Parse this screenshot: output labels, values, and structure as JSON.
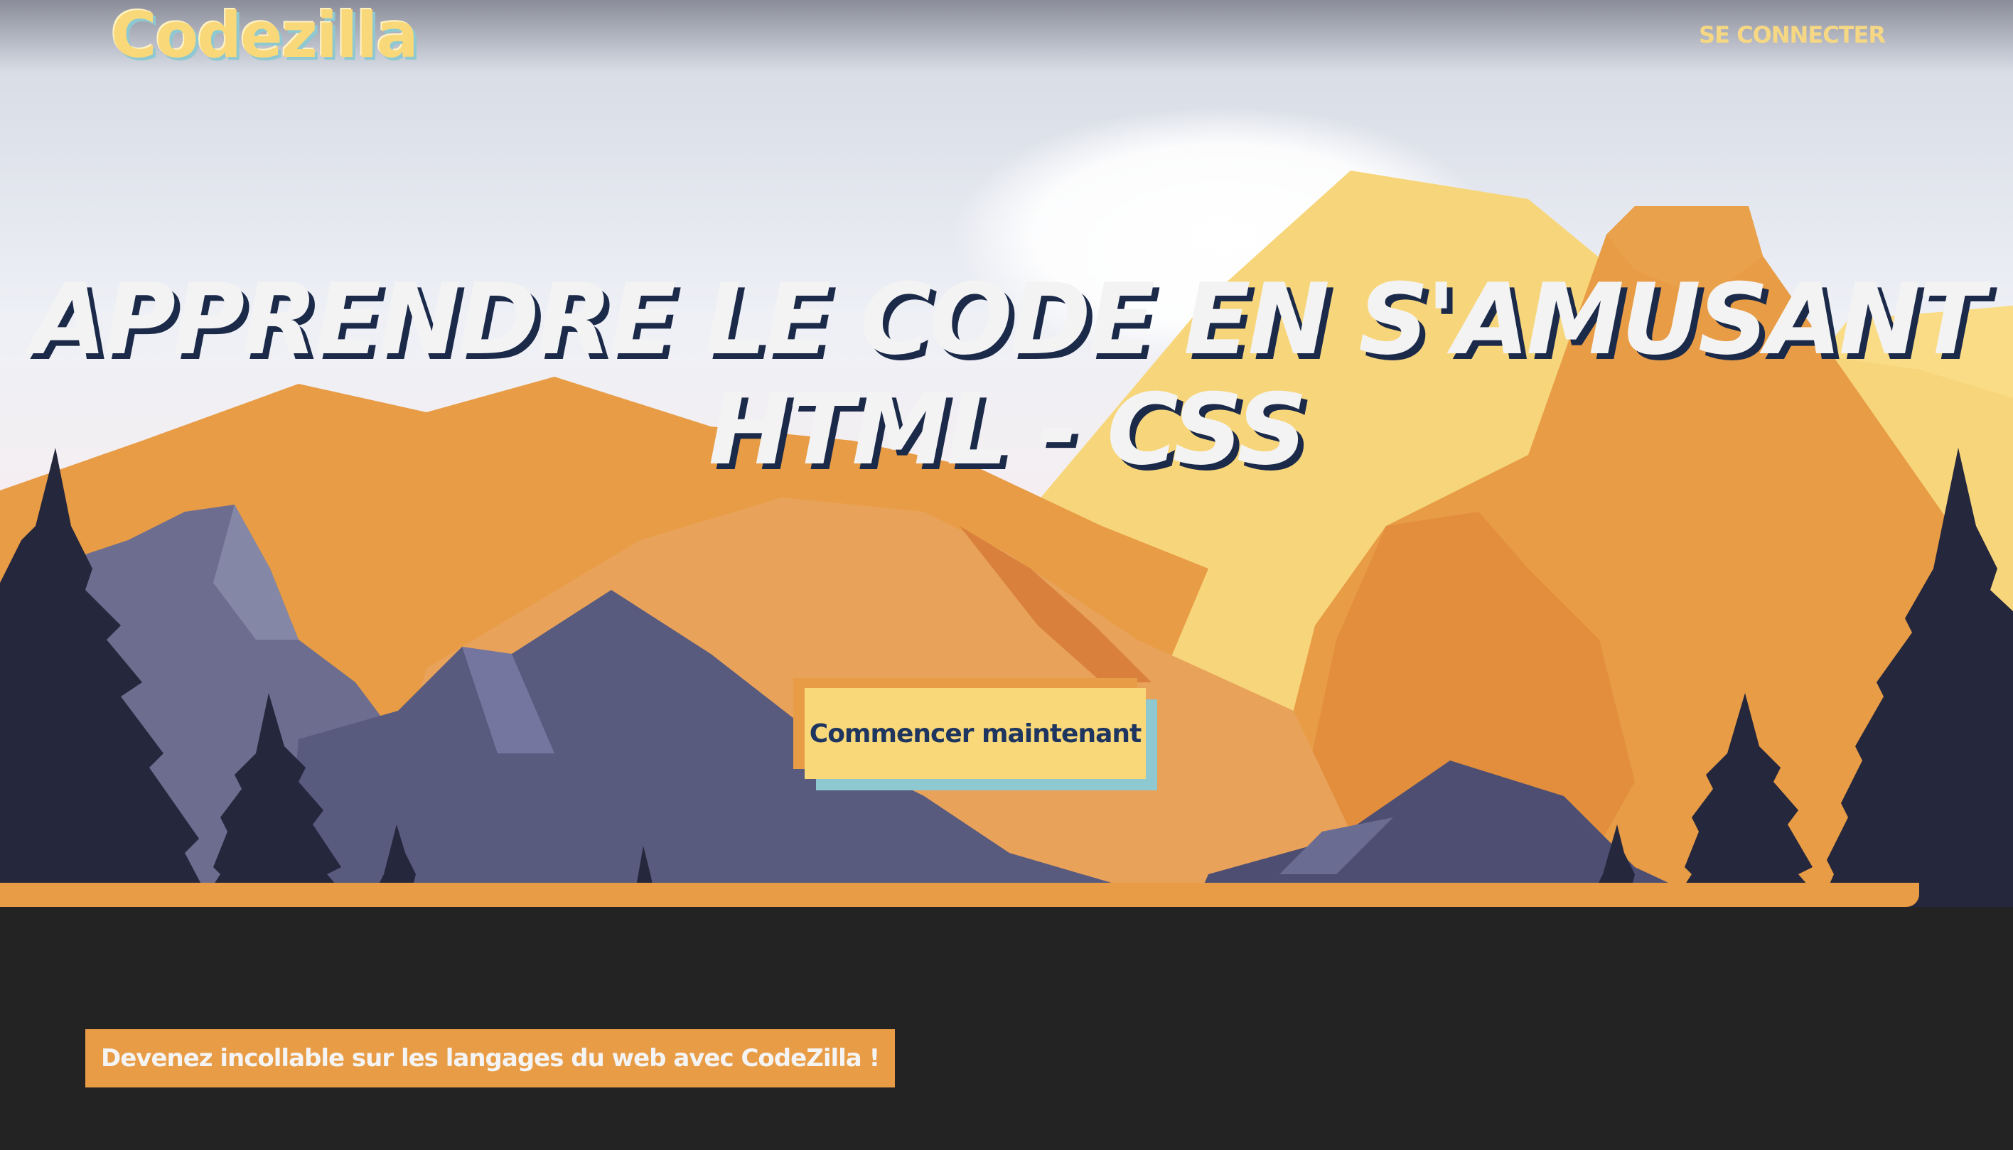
{
  "header": {
    "logo": "Codezilla",
    "login_label": "SE CONNECTER"
  },
  "hero": {
    "headline_line1": "APPRENDRE LE CODE EN S'AMUSANT",
    "headline_line2": "HTML - CSS",
    "cta_label": "Commencer maintenant"
  },
  "footer": {
    "tagline": "Devenez incollable sur les langages du web avec CodeZilla !"
  },
  "colors": {
    "accent_yellow": "#f9d87a",
    "accent_orange": "#e89c45",
    "accent_blue": "#8ec8d1",
    "navy": "#1e3560",
    "dark_bg": "#232323"
  }
}
